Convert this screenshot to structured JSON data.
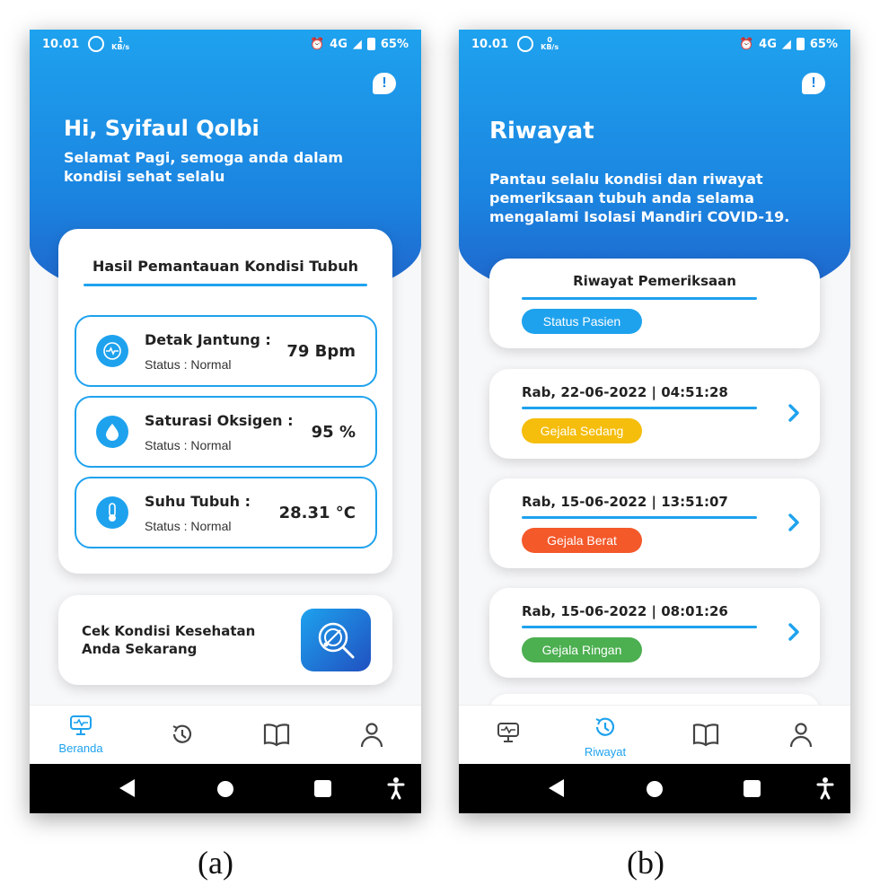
{
  "phone_a": {
    "status_bar": {
      "time": "10.01",
      "net_speed_value": "1",
      "net_speed_unit": "KB/s",
      "network": "4G",
      "battery": "65%"
    },
    "greeting": {
      "title": "Hi, Syifaul Qolbi",
      "subtitle": "Selamat Pagi, semoga anda dalam kondisi sehat selalu"
    },
    "monitor_card": {
      "title": "Hasil Pemantauan Kondisi Tubuh",
      "vitals": [
        {
          "label": "Detak Jantung :",
          "status": "Status : Normal",
          "value": "79 Bpm",
          "icon": "heartbeat-icon"
        },
        {
          "label": "Saturasi Oksigen :",
          "status": "Status : Normal",
          "value": "95 %",
          "icon": "water-drop-icon"
        },
        {
          "label": "Suhu Tubuh :",
          "status": "Status : Normal",
          "value": "28.31 °C",
          "icon": "thermometer-icon"
        }
      ]
    },
    "cek_card": {
      "text": "Cek Kondisi Kesehatan Anda Sekarang",
      "icon": "stethoscope-search-icon"
    },
    "nav": {
      "active_label": "Beranda"
    }
  },
  "phone_b": {
    "status_bar": {
      "time": "10.01",
      "net_speed_value": "0",
      "net_speed_unit": "KB/s",
      "network": "4G",
      "battery": "65%"
    },
    "title": "Riwayat",
    "description": "Pantau selalu kondisi dan riwayat pemeriksaan tubuh anda selama mengalami Isolasi Mandiri COVID-19.",
    "history_header": {
      "title": "Riwayat Pemeriksaan",
      "status_label": "Status Pasien"
    },
    "history": [
      {
        "datetime": "Rab, 22-06-2022 | 04:51:28",
        "status": "Gejala Sedang",
        "color": "#f5bd0c"
      },
      {
        "datetime": "Rab, 15-06-2022 | 13:51:07",
        "status": "Gejala Berat",
        "color": "#f4592a"
      },
      {
        "datetime": "Rab, 15-06-2022 | 08:01:26",
        "status": "Gejala Ringan",
        "color": "#4caf50"
      }
    ],
    "nav": {
      "active_label": "Riwayat"
    }
  },
  "captions": {
    "a": "(a)",
    "b": "(b)"
  },
  "colors": {
    "accent": "#1ea2ee",
    "icon_gray": "#444444"
  }
}
